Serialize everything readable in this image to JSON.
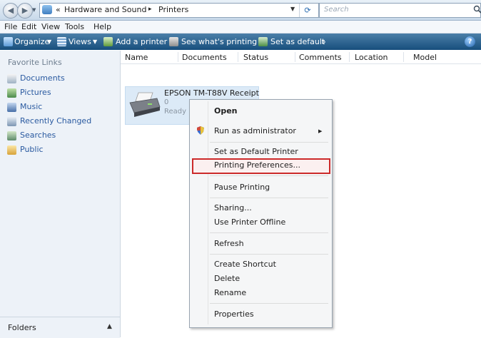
{
  "addressbar": {
    "breadcrumb_prefix": "«",
    "crumbs": [
      "Hardware and Sound",
      "Printers"
    ],
    "separator": "▸",
    "search_placeholder": "Search"
  },
  "menubar": {
    "items": [
      "File",
      "Edit",
      "View",
      "Tools",
      "Help"
    ]
  },
  "toolbar": {
    "organize": "Organize",
    "views": "Views",
    "add_printer": "Add a printer",
    "see_printing": "See what's printing",
    "set_default": "Set as default",
    "more": "»"
  },
  "sidebar": {
    "title": "Favorite Links",
    "links": [
      "Documents",
      "Pictures",
      "Music",
      "Recently Changed",
      "Searches",
      "Public"
    ],
    "folders_label": "Folders"
  },
  "columns": [
    "Name",
    "Documents",
    "Status",
    "Comments",
    "Location",
    "Model"
  ],
  "printer": {
    "name": "EPSON TM-T88V Receipt",
    "documents": "0",
    "status": "Ready"
  },
  "context_menu": {
    "items": [
      "Open",
      "Run as administrator",
      "Set as Default Printer",
      "Printing Preferences...",
      "Pause Printing",
      "Sharing...",
      "Use Printer Offline",
      "Refresh",
      "Create Shortcut",
      "Delete",
      "Rename",
      "Properties"
    ],
    "highlighted": "Printing Preferences..."
  },
  "colors": {
    "toolbar": "#1f5a8a",
    "selection": "#dceaf7",
    "highlight_border": "#cc2a2a",
    "link": "#2a5aa0"
  }
}
